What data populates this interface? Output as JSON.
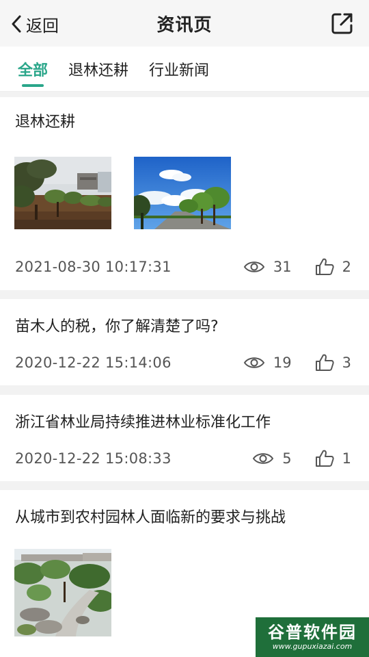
{
  "header": {
    "back_label": "返回",
    "title": "资讯页"
  },
  "tabs": [
    {
      "label": "全部",
      "active": true
    },
    {
      "label": "退林还耕",
      "active": false
    },
    {
      "label": "行业新闻",
      "active": false
    }
  ],
  "articles": [
    {
      "title": "退林还耕",
      "date": "2021-08-30 10:17:31",
      "views": "31",
      "likes": "2",
      "images": [
        "nursery-trees-photo",
        "tree-lined-road-photo"
      ]
    },
    {
      "title": "苗木人的税，你了解清楚了吗?",
      "date": "2020-12-22 15:14:06",
      "views": "19",
      "likes": "3",
      "images": []
    },
    {
      "title": "浙江省林业局持续推进林业标准化工作",
      "date": "2020-12-22 15:08:33",
      "views": "5",
      "likes": "1",
      "images": []
    },
    {
      "title": "从城市到农村园林人面临新的要求与挑战",
      "images": [
        "garden-landscape-photo"
      ]
    }
  ],
  "icons": {
    "back": "chevron-left-icon",
    "share": "external-share-icon",
    "views": "eye-icon",
    "likes": "thumbs-up-icon"
  },
  "colors": {
    "accent": "#2aa68a",
    "text": "#222222",
    "meta": "#555555"
  },
  "watermark": {
    "title": "谷普软件园",
    "url": "www.gupuxiazai.com"
  }
}
